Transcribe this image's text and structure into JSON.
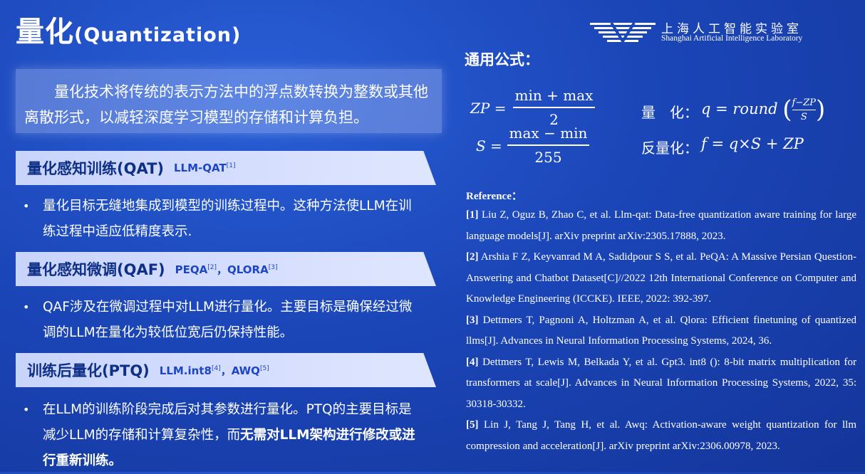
{
  "title": {
    "cn": "量化",
    "en": "(Quantization)"
  },
  "logo": {
    "cn": "上海人工智能实验室",
    "en": "Shanghai Artificial Intelligence Laboratory"
  },
  "intro": "量化技术将传统的表示方法中的浮点数转换为整数或其他离散形式，以减轻深度学习模型的存储和计算负担。",
  "sections": [
    {
      "label": "量化感知训练(QAT)",
      "refs": [
        {
          "name": "LLM-QAT",
          "sup": "[1]"
        }
      ],
      "bullet": "量化目标无缝地集成到模型的训练过程中。这种方法使LLM在训练过程中适应低精度表示."
    },
    {
      "label": "量化感知微调(QAF)",
      "refs": [
        {
          "name": "PEQA",
          "sup": "[2]"
        },
        {
          "name": "QLORA",
          "sup": "[3]"
        }
      ],
      "bullet": "QAF涉及在微调过程中对LLM进行量化。主要目标是确保经过微调的LLM在量化为较低位宽后仍保持性能。"
    },
    {
      "label": "训练后量化(PTQ)",
      "refs": [
        {
          "name": "LLM.int8",
          "sup": "[4]"
        },
        {
          "name": "AWQ",
          "sup": "[5]"
        }
      ],
      "bullet_normal": "在LLM的训练阶段完成后对其参数进行量化。PTQ的主要目标是减少LLM的存储和计算复杂性，而",
      "bullet_bold": "无需对LLM架构进行修改或进行重新训练。"
    }
  ],
  "ref_separator": "，",
  "formula": {
    "title": "通用公式：",
    "zp_lhs": "ZP =",
    "zp_num": "min + max",
    "zp_den": "2",
    "s_lhs": "S =",
    "s_num": "max − min",
    "s_den": "255",
    "quant_label": "量　化：",
    "quant_lhs": "q = round",
    "quant_frac_num": "f−ZP",
    "quant_frac_den": "S",
    "dequant_label": "反量化：",
    "dequant_expr": "f = q×S + ZP"
  },
  "reference_title": "Reference：",
  "references": [
    {
      "num": "[1]",
      "text": "Liu Z, Oguz B, Zhao C, et al. Llm-qat: Data-free quantization aware training for large language models[J]. arXiv preprint arXiv:2305.17888, 2023."
    },
    {
      "num": "[2]",
      "text": "Arshia F Z, Keyvanrad M A, Sadidpour S S, et al. PeQA: A Massive Persian Question-Answering and Chatbot Dataset[C]//2022 12th International Conference on Computer and Knowledge Engineering (ICCKE). IEEE, 2022: 392-397."
    },
    {
      "num": "[3]",
      "text": "Dettmers T, Pagnoni A, Holtzman A, et al. Qlora: Efficient finetuning of quantized llms[J]. Advances in Neural Information Processing Systems, 2024, 36."
    },
    {
      "num": "[4]",
      "text": "Dettmers T, Lewis M, Belkada Y, et al. Gpt3. int8 (): 8-bit matrix multiplication for transformers at scale[J]. Advances in Neural Information Processing Systems, 2022, 35: 30318-30332."
    },
    {
      "num": "[5]",
      "text": "Lin J, Tang J, Tang H, et al. Awq: Activation-aware weight quantization for llm compression and acceleration[J]. arXiv preprint arXiv:2306.00978, 2023."
    }
  ]
}
